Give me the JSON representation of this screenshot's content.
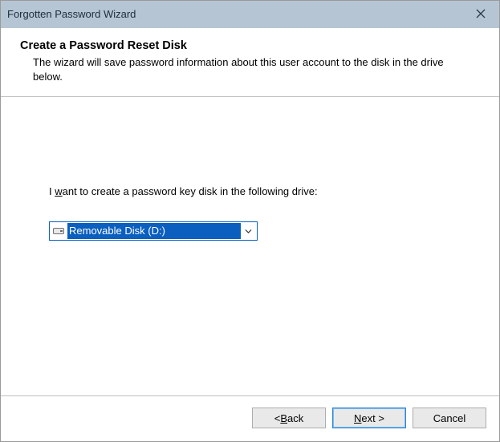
{
  "titlebar": {
    "title": "Forgotten Password Wizard"
  },
  "header": {
    "heading": "Create a Password Reset Disk",
    "description": "The wizard will save password information about this user account to the disk in the drive below."
  },
  "content": {
    "prompt_prefix": "I ",
    "prompt_mnemonic": "w",
    "prompt_suffix": "ant to create a password key disk in the following drive:",
    "drive_selected": "Removable Disk (D:)"
  },
  "footer": {
    "back_prefix": "< ",
    "back_mnemonic": "B",
    "back_suffix": "ack",
    "next_mnemonic": "N",
    "next_suffix": "ext >",
    "cancel": "Cancel"
  }
}
